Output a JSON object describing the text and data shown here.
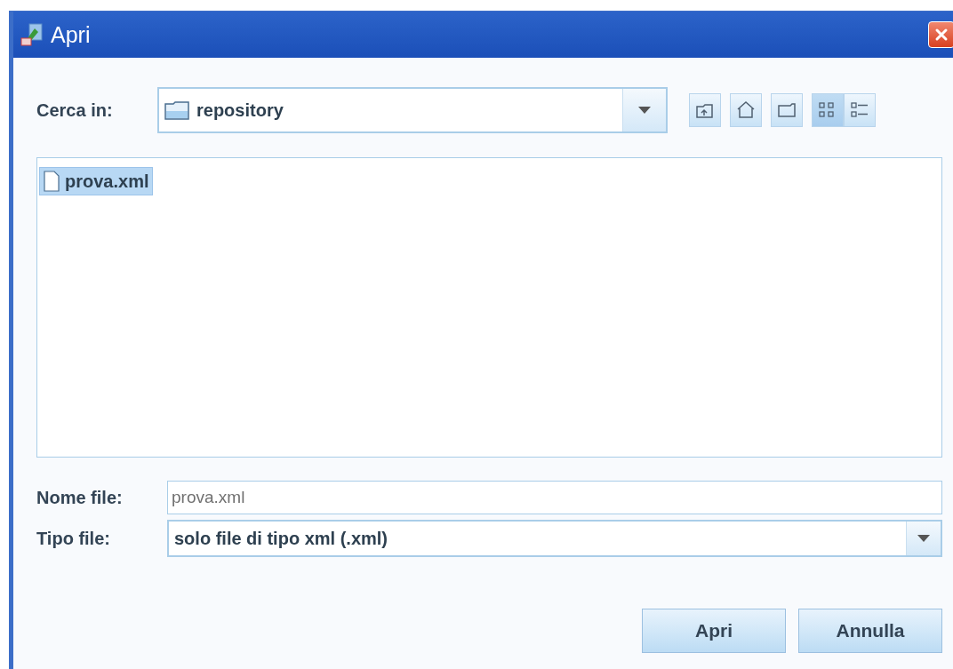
{
  "window": {
    "title": "Apri"
  },
  "look_in": {
    "label": "Cerca in:",
    "value": "repository"
  },
  "toolbar": [
    {
      "kind": "up",
      "selected": false
    },
    {
      "kind": "home",
      "selected": false
    },
    {
      "kind": "new-folder",
      "selected": false
    },
    {
      "kind": "list",
      "selected": true
    },
    {
      "kind": "details",
      "selected": false
    }
  ],
  "files": [
    {
      "name": "prova.xml",
      "selected": true
    }
  ],
  "file_name": {
    "label": "Nome file:",
    "value": "prova.xml"
  },
  "file_type": {
    "label": "Tipo file:",
    "value": "solo file di tipo xml (.xml)"
  },
  "buttons": [
    "Apri",
    "Annulla"
  ]
}
